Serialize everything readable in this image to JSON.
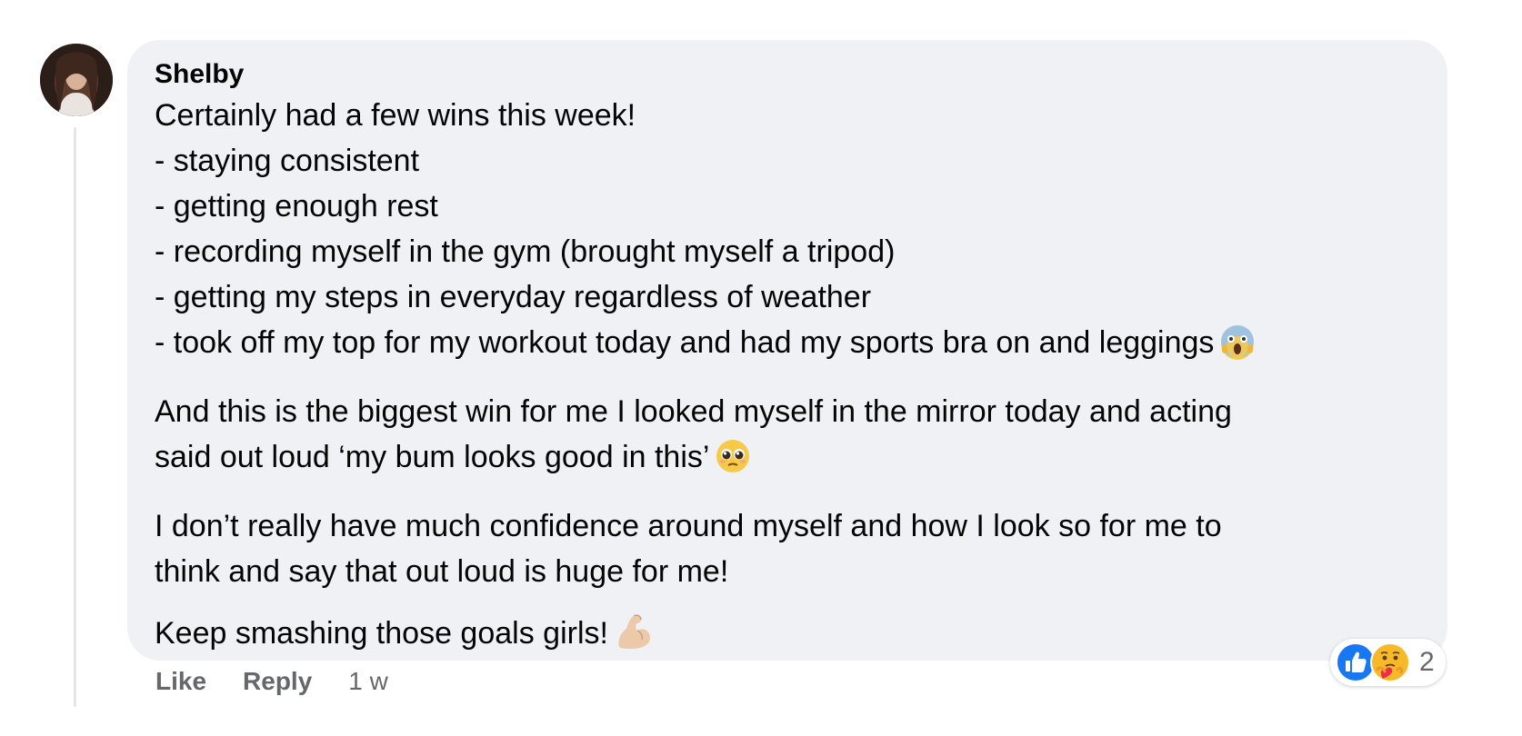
{
  "comment": {
    "author": "Shelby",
    "paragraphs": [
      {
        "lines": [
          "Certainly had a few wins this week!",
          "- staying consistent",
          "- getting enough rest",
          "- recording myself in the gym (brought myself a tripod)",
          "- getting my steps in everyday regardless of weather",
          "- took off my top for my workout today and had my sports bra on and leggings"
        ]
      },
      {
        "lines": [
          "And this is the biggest win for me I looked myself in the mirror today and acting",
          "said out loud ‘my bum looks good in this’"
        ]
      },
      {
        "lines": [
          "I don’t really have much confidence around myself and how I look so for me to",
          "think and say that out loud is huge for me!"
        ]
      },
      {
        "lines": [
          "Keep smashing those goals girls!"
        ]
      }
    ],
    "emojis": {
      "p1_last_line": "face-screaming-in-fear-emoji",
      "p2_last_line": "pleading-face-emoji",
      "p4_last_line": "flexed-biceps-emoji"
    }
  },
  "actions": {
    "like_label": "Like",
    "reply_label": "Reply",
    "timestamp": "1 w"
  },
  "reactions": {
    "icons": [
      "like-reaction-icon",
      "care-reaction-icon"
    ],
    "count": "2"
  },
  "colors": {
    "bubble_bg": "#f0f1f5",
    "secondary_text": "#65676b",
    "like_blue": "#1877f2",
    "care_yellow": "#f7b928"
  }
}
